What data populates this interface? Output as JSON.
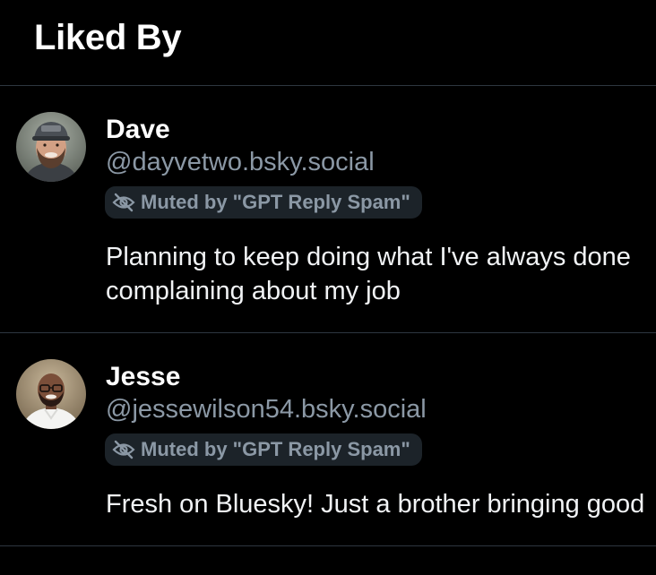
{
  "header": {
    "title": "Liked By"
  },
  "users": [
    {
      "display_name": "Dave",
      "handle": "@dayvetwo.bsky.social",
      "muted_label": "Muted by \"GPT Reply Spam\"",
      "bio_lines": [
        "Planning to keep doing what I've always done",
        "complaining about my job"
      ]
    },
    {
      "display_name": "Jesse",
      "handle": "@jessewilson54.bsky.social",
      "muted_label": "Muted by \"GPT Reply Spam\"",
      "bio_lines": [
        "Fresh on Bluesky! Just a brother bringing good"
      ]
    }
  ],
  "colors": {
    "background": "#000000",
    "divider": "#2e3640",
    "secondary_text": "#8b98a5",
    "pill_background": "#1c2329"
  },
  "icons": {
    "muted": "eye-slash-icon",
    "avatar_1": "avatar-photo-bearded-man-cap",
    "avatar_2": "avatar-photo-man-glasses"
  }
}
